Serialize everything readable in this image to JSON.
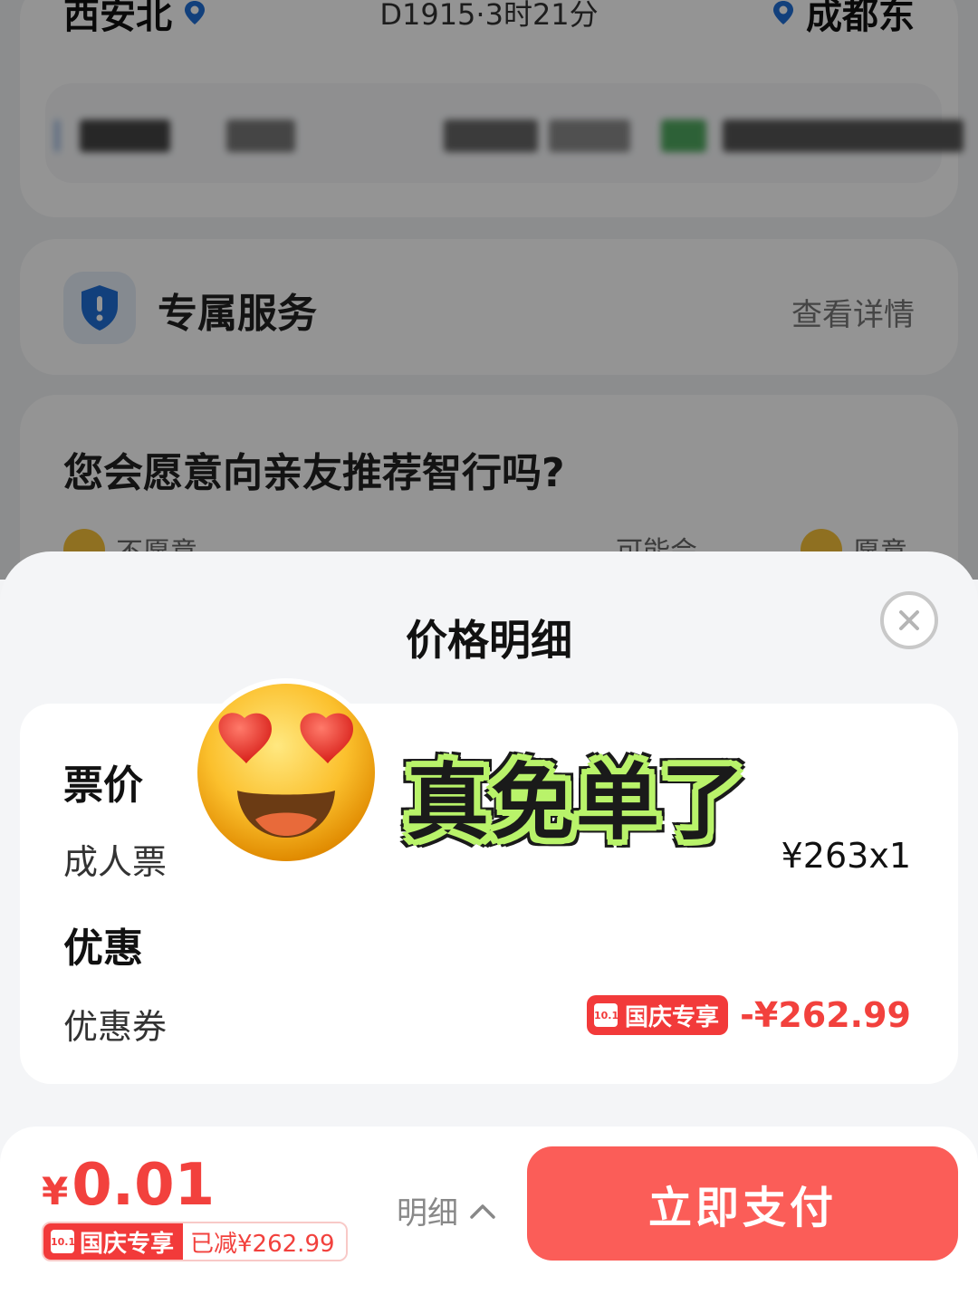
{
  "trip": {
    "from_station": "西安北",
    "to_station": "成都东",
    "train_info": "D1915·3时21分"
  },
  "service": {
    "title": "专属服务",
    "link": "查看详情"
  },
  "survey": {
    "question": "您会愿意向亲友推荐智行吗?",
    "options": [
      "不愿意",
      "可能会",
      "愿意"
    ]
  },
  "sheet": {
    "title": "价格明细",
    "ticket_section": "票价",
    "ticket_row_label": "成人票",
    "ticket_row_value": "¥263x1",
    "discount_section": "优惠",
    "coupon_label": "优惠券",
    "coupon_badge": "国庆专享",
    "coupon_badge_date": "10.1",
    "coupon_value": "-¥262.99"
  },
  "sticker": {
    "text": "真免单了"
  },
  "bottom": {
    "currency": "¥",
    "total": "0.01",
    "promo_label": "国庆专享",
    "promo_date": "10.1",
    "reduced": "已减¥262.99",
    "detail_toggle": "明细",
    "pay_button": "立即支付"
  },
  "colors": {
    "accent_red": "#f2413d",
    "pay_button": "#fb5d58",
    "pin_blue": "#1f6fd6",
    "sticker_outline": "#b9f36a"
  }
}
